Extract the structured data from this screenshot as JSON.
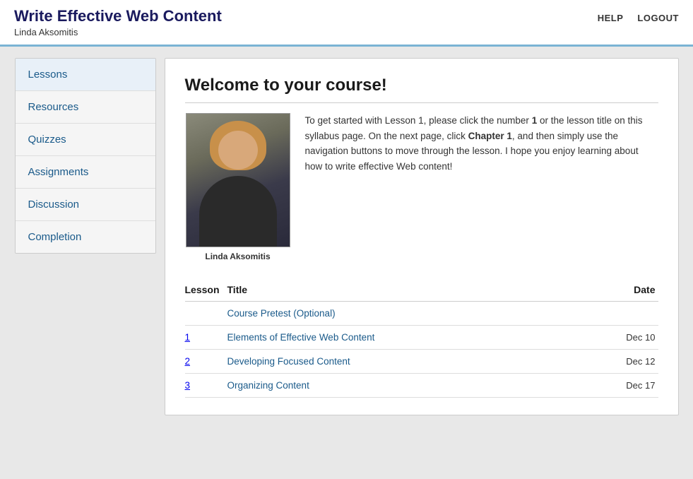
{
  "header": {
    "title": "Write Effective Web Content",
    "subtitle": "Linda Aksomitis",
    "nav": {
      "help": "HELP",
      "logout": "LOGOUT"
    }
  },
  "sidebar": {
    "items": [
      {
        "label": "Lessons",
        "active": true
      },
      {
        "label": "Resources",
        "active": false
      },
      {
        "label": "Quizzes",
        "active": false
      },
      {
        "label": "Assignments",
        "active": false
      },
      {
        "label": "Discussion",
        "active": false
      },
      {
        "label": "Completion",
        "active": false
      }
    ]
  },
  "content": {
    "welcome_title": "Welcome to your course!",
    "intro_text_part1": "To get started with Lesson 1, please click the number ",
    "intro_bold1": "1",
    "intro_text_part2": " or the lesson title on this syllabus page. On the next page, click ",
    "intro_bold2": "Chapter 1",
    "intro_text_part3": ", and then simply use the navigation buttons to move through the lesson. I hope you enjoy learning about how to write effective Web content!",
    "instructor_name": "Linda Aksomitis",
    "table": {
      "headers": {
        "lesson": "Lesson",
        "title": "Title",
        "date": "Date"
      },
      "rows": [
        {
          "lesson": "",
          "title": "Course Pretest (Optional)",
          "date": ""
        },
        {
          "lesson": "1",
          "title": "Elements of Effective Web Content",
          "date": "Dec 10"
        },
        {
          "lesson": "2",
          "title": "Developing Focused Content",
          "date": "Dec 12"
        },
        {
          "lesson": "3",
          "title": "Organizing Content",
          "date": "Dec 17"
        }
      ]
    }
  }
}
